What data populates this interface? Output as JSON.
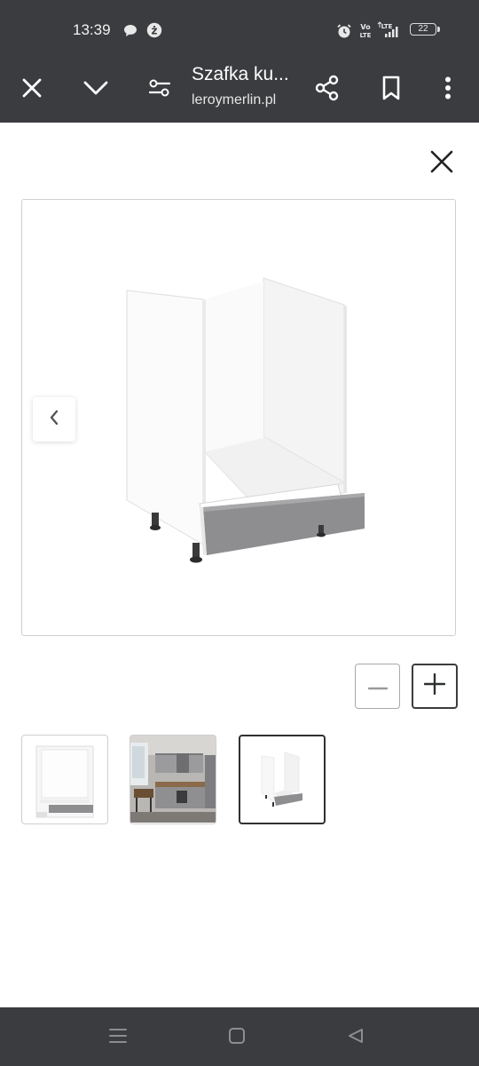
{
  "status_bar": {
    "time": "13:39",
    "battery": "22",
    "icons": [
      "chat-bubble-icon",
      "zabka-app-icon",
      "alarm-icon",
      "volte-icon",
      "lte-signal-icon",
      "battery-icon"
    ]
  },
  "toolbar": {
    "title": "Szafka ku...",
    "url": "leroymerlin.pl",
    "icons": [
      "close-icon",
      "chevron-down-icon",
      "tune-icon",
      "share-icon",
      "bookmark-icon",
      "more-vert-icon"
    ]
  },
  "gallery": {
    "icons": [
      "close-icon",
      "chevron-left-icon",
      "minus-icon",
      "plus-icon"
    ],
    "thumbnails": [
      "cabinet-front-thumbnail",
      "kitchen-room-thumbnail",
      "cabinet-angled-thumbnail"
    ],
    "selected_thumbnail": 3
  },
  "nav_bar": {
    "icons": [
      "menu-icon",
      "home-square-icon",
      "back-triangle-icon"
    ]
  },
  "colors": {
    "bar_background": "#3b3c3f",
    "page_background": "#ffffff",
    "border": "#cfcfcf",
    "drawer_gray": "#8e8e90"
  }
}
